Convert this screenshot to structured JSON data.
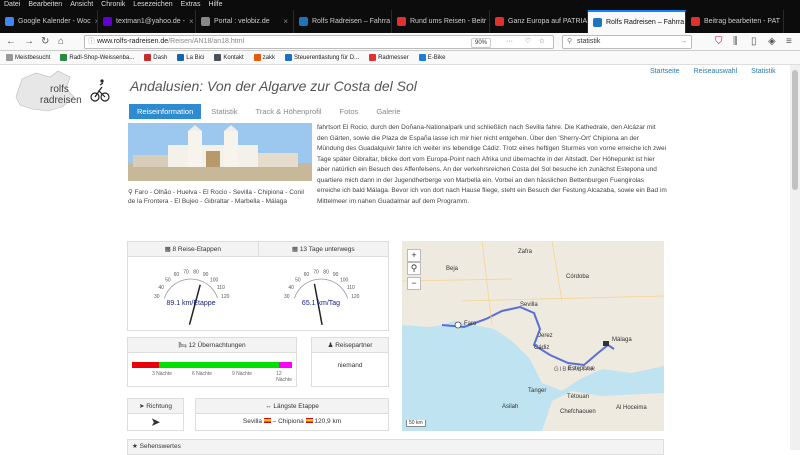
{
  "menu": [
    "Datei",
    "Bearbeiten",
    "Ansicht",
    "Chronik",
    "Lesezeichen",
    "Extras",
    "Hilfe"
  ],
  "tabs": [
    {
      "label": "Google Kalender - Woc",
      "color": "#4285f4"
    },
    {
      "label": "textman1@yahoo.de -",
      "color": "#6001d2"
    },
    {
      "label": "Portal : velobiz.de",
      "color": "#888888"
    },
    {
      "label": "Rolfs Radreisen – Fahrra",
      "color": "#1e73be"
    },
    {
      "label": "Rund ums Reisen - Beitr",
      "color": "#e03131"
    },
    {
      "label": "Ganz Europa auf PATRIA",
      "color": "#e03131"
    },
    {
      "label": "Rolfs Radreisen – Fahrra",
      "color": "#1e73be",
      "active": true
    },
    {
      "label": "Beitrag bearbeiten - PAT",
      "color": "#e03131"
    }
  ],
  "url": {
    "domain": "www.rolfs-radreisen.de",
    "path": "/Reisen/AN18/an18.html"
  },
  "zoom": "90%",
  "search": "statistik",
  "bookmarks": [
    {
      "label": "Meistbesucht",
      "color": "#999"
    },
    {
      "label": "Radl-Shop-Weissenba...",
      "color": "#2b8a3e"
    },
    {
      "label": "Dash",
      "color": "#c92a2a"
    },
    {
      "label": "La Bici",
      "color": "#1864ab"
    },
    {
      "label": "Kontakt",
      "color": "#495057"
    },
    {
      "label": "zakk",
      "color": "#e8590c"
    },
    {
      "label": "Steuerentlastung für D...",
      "color": "#1971c2"
    },
    {
      "label": "Radmesser",
      "color": "#e03131"
    },
    {
      "label": "E-Bike",
      "color": "#1c7ed6"
    }
  ],
  "site": {
    "logo_line1": "rolfs",
    "logo_line2": "radreisen",
    "title": "Andalusien: Von der Algarve zur Costa del Sol",
    "toplinks": [
      "Startseite",
      "Reiseauswahl",
      "Statistik"
    ],
    "tabs": [
      "Reiseinformation",
      "Statistik",
      "Track & Höhenprofil",
      "Fotos",
      "Galerie"
    ]
  },
  "route": "Faro - Olhão - Huelva - El Rocio - Sevilla - Chipiona - Conil de la Frontera - El Bujeo - Gibraltar - Marbella - Málaga",
  "desc": "fahrtsort El Rocio, durch den Doñana-Nationalpark und schließlich nach Sevilla fahre. Die Kathedrale, den Alcázar mit den Gärten, sowie die Plaza de España lasse ich mir hier nicht entgehen. Über den 'Sherry-Ort' Chipiona an der Mündung des Guadalquivir fahre ich weiter ins lebendige Cádiz. Trotz eines heftigen Sturmes von vorne erreiche ich zwei Tage später Gibraltar, blicke dort vom Europa-Point nach Afrika und übernachte in der Altstadt. Der Höhepunkt ist hier aber natürlich ein Besuch des Affenfelsens. An der verkehrsreichen Costa del Sol besuche ich zunächst Estepona und quartiere mich dann in der Jugendherberge von Marbella ein. Vorbei an den hässlichen Bettenburgen Fuengirolas erreiche ich bald Málaga. Bevor ich von dort nach Hause fliege, steht ein Besuch der Festung Alcazaba, sowie ein Bad im Mittelmeer im nahen Guadalmar auf dem Programm.",
  "stats": {
    "etappen": "8 Reise-Etappen",
    "tage": "13 Tage unterwegs",
    "gauge1": {
      "value_text": "89.1 km/Etappe",
      "value": 89.1
    },
    "gauge2": {
      "value_text": "65.1 km/Tag",
      "value": 65.1
    },
    "gauge_ticks": [
      "30",
      "40",
      "50",
      "60",
      "70",
      "80",
      "90",
      "100",
      "110",
      "120"
    ],
    "naechte": "12 Übernachtungen",
    "partner_hdr": "Reisepartner",
    "partner": "niemand",
    "bar_ticks": [
      "3 Nächte",
      "6 Nächte",
      "9 Nächte",
      "12 Nächte"
    ],
    "bar_segments": [
      {
        "nights": 2,
        "color": "#e8000b"
      },
      {
        "nights": 9,
        "color": "#00e000"
      },
      {
        "nights": 1,
        "color": "#ff00ff"
      }
    ],
    "richtung_hdr": "Richtung",
    "longest_hdr": "Längste Etappe",
    "longest": {
      "from": "Sevilla",
      "to": "Chipiona",
      "dist": "120,9 km"
    },
    "next_hdr": "Sehenswertes"
  },
  "map": {
    "labels": [
      "Zafra",
      "Beja",
      "Córdoba",
      "Sevilla",
      "Faro",
      "Jerez",
      "Cádiz",
      "Málaga",
      "Estepona",
      "Tanger",
      "Tétouan",
      "Asilah",
      "Chefchaouen",
      "Al Hoceima",
      "GIBRALTAR"
    ],
    "scale": "50 km"
  }
}
